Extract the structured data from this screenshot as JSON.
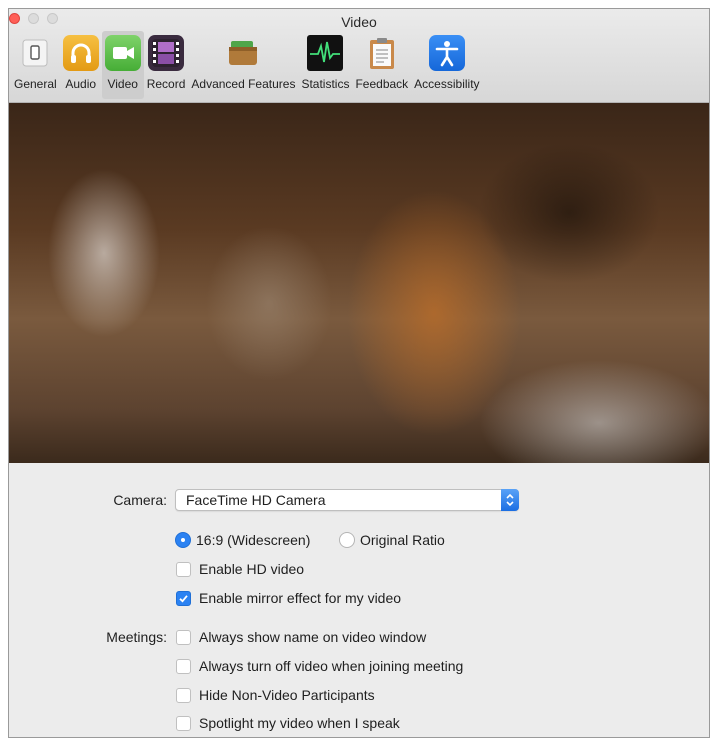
{
  "window": {
    "title": "Video"
  },
  "toolbar": {
    "items": [
      {
        "label": "General",
        "icon": "general-switch-icon"
      },
      {
        "label": "Audio",
        "icon": "headphones-icon"
      },
      {
        "label": "Video",
        "icon": "video-camera-icon",
        "selected": true
      },
      {
        "label": "Record",
        "icon": "film-strip-icon"
      },
      {
        "label": "Advanced Features",
        "icon": "wallet-icon"
      },
      {
        "label": "Statistics",
        "icon": "waveform-icon"
      },
      {
        "label": "Feedback",
        "icon": "clipboard-icon"
      },
      {
        "label": "Accessibility",
        "icon": "accessibility-icon"
      }
    ]
  },
  "settings": {
    "camera_label": "Camera:",
    "camera_value": "FaceTime HD Camera",
    "ratio_widescreen": "16:9 (Widescreen)",
    "ratio_original": "Original Ratio",
    "enable_hd": "Enable HD video",
    "mirror": "Enable mirror effect for my video",
    "meetings_label": "Meetings:",
    "show_name": "Always show name on video window",
    "turn_off_video": "Always turn off video when joining meeting",
    "hide_non_video": "Hide Non-Video Participants",
    "spotlight": "Spotlight my video when I speak"
  },
  "state": {
    "ratio": "16:9 (Widescreen)",
    "enable_hd": false,
    "mirror": true,
    "show_name": false,
    "turn_off_video": false,
    "hide_non_video": false,
    "spotlight": false
  },
  "colors": {
    "accent": "#2b82f2",
    "close_button": "#ff5f57"
  }
}
